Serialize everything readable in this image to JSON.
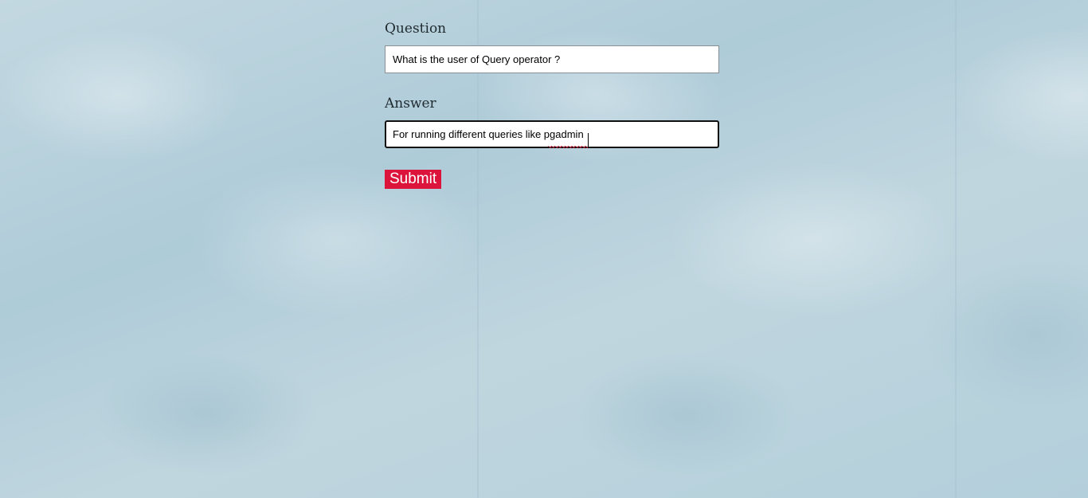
{
  "form": {
    "question_label": "Question",
    "question_value": "What is the user of Query operator ?",
    "answer_label": "Answer",
    "answer_value": "For running different queries like pgadmin",
    "submit_label": "Submit"
  },
  "colors": {
    "submit_background": "#dc143c",
    "submit_text": "#ffffff",
    "page_background": "#b9d1dc",
    "spellcheck_underline": "#d21f3c"
  }
}
